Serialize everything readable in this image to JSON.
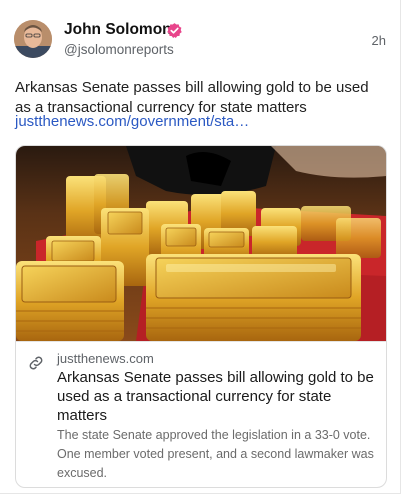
{
  "author": {
    "name": "John Solomon",
    "handle": "@jsolomonreports",
    "verified_badge_icon": "verified-badge-icon",
    "badge_color": "#e8458b"
  },
  "post": {
    "timestamp": "2h",
    "text": "Arkansas Senate passes bill allowing gold to be used as a transactional currency for state matters",
    "link_text": "justthenews.com/government/sta…"
  },
  "link_card": {
    "icon": "link-icon",
    "domain": "justthenews.com",
    "title": "Arkansas Senate passes bill allowing gold to be used as a transactional currency for state matters",
    "description": "The state Senate approved the legislation in a 33-0 vote. One member voted present, and a second lawmaker was excused."
  },
  "colors": {
    "link": "#2b59c3",
    "muted": "#5f6368",
    "gold": "#d9a520",
    "tray_red": "#c9262a"
  }
}
